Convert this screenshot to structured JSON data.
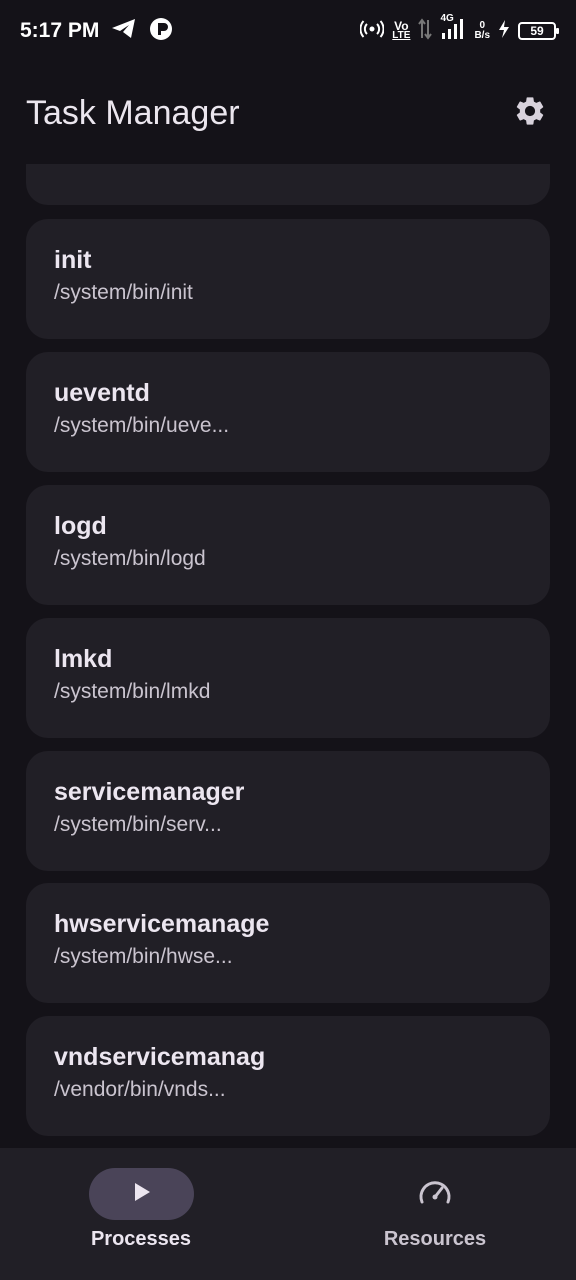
{
  "status_bar": {
    "time": "5:17 PM",
    "net_top": "Vo",
    "net_bottom": "LTE",
    "gen": "4G",
    "speed_value": "0",
    "speed_unit": "B/s",
    "battery": "59"
  },
  "app_bar": {
    "title": "Task Manager",
    "settings_icon": "gear-icon"
  },
  "processes": [
    {
      "name": "init",
      "path": "/system/bin/init"
    },
    {
      "name": "ueventd",
      "path": "/system/bin/ueve..."
    },
    {
      "name": "logd",
      "path": "/system/bin/logd"
    },
    {
      "name": "lmkd",
      "path": "/system/bin/lmkd"
    },
    {
      "name": "servicemanager",
      "path": "/system/bin/serv..."
    },
    {
      "name": "hwservicemanage",
      "path": "/system/bin/hwse..."
    },
    {
      "name": "vndservicemanag",
      "path": "/vendor/bin/vnds..."
    }
  ],
  "bottom_nav": {
    "items": [
      {
        "label": "Processes",
        "icon": "play-icon",
        "active": true
      },
      {
        "label": "Resources",
        "icon": "speedometer-icon",
        "active": false
      }
    ]
  },
  "colors": {
    "background": "#141218",
    "card": "#211f26",
    "nav_background": "#211f26",
    "active_pill": "#4a4458",
    "text_primary": "#ece6f0",
    "text_secondary": "#cac4cf"
  }
}
